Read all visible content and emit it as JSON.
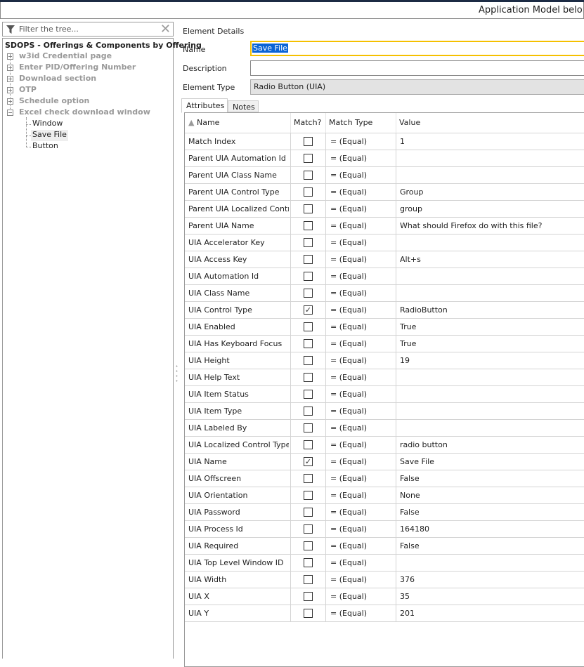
{
  "window": {
    "title": "Application Model belong"
  },
  "filter": {
    "placeholder": "Filter the tree..."
  },
  "tree": {
    "root": "SDOPS - Offerings & Components by Offering",
    "nodes": [
      {
        "label": "w3id Credential page",
        "expanded": false
      },
      {
        "label": "Enter PID/Offering Number",
        "expanded": false
      },
      {
        "label": "Download section",
        "expanded": false
      },
      {
        "label": "OTP",
        "expanded": false
      },
      {
        "label": "Schedule option",
        "expanded": false
      },
      {
        "label": "Excel check download window",
        "expanded": true
      }
    ],
    "leaves": [
      "Window",
      "Save File",
      "Button"
    ],
    "selected": "Save File"
  },
  "details": {
    "heading": "Element Details",
    "name_label": "Name",
    "name_value": "Save File",
    "description_label": "Description",
    "description_value": "",
    "type_label": "Element Type",
    "type_value": "Radio Button (UIA)"
  },
  "tabs": [
    "Attributes",
    "Notes"
  ],
  "table": {
    "headers": [
      "Name",
      "Match?",
      "Match Type",
      "Value"
    ],
    "rows": [
      [
        "Match Index",
        false,
        "=  (Equal)",
        "1"
      ],
      [
        "Parent UIA Automation Id",
        false,
        "=  (Equal)",
        ""
      ],
      [
        "Parent UIA Class Name",
        false,
        "=  (Equal)",
        ""
      ],
      [
        "Parent UIA Control Type",
        false,
        "=  (Equal)",
        "Group"
      ],
      [
        "Parent UIA Localized Contr...",
        false,
        "=  (Equal)",
        "group"
      ],
      [
        "Parent UIA Name",
        false,
        "=  (Equal)",
        "What should Firefox do with this file?"
      ],
      [
        "UIA Accelerator Key",
        false,
        "=  (Equal)",
        ""
      ],
      [
        "UIA Access Key",
        false,
        "=  (Equal)",
        "Alt+s"
      ],
      [
        "UIA Automation Id",
        false,
        "=  (Equal)",
        ""
      ],
      [
        "UIA Class Name",
        false,
        "=  (Equal)",
        ""
      ],
      [
        "UIA Control Type",
        true,
        "=  (Equal)",
        "RadioButton"
      ],
      [
        "UIA Enabled",
        false,
        "=  (Equal)",
        "True"
      ],
      [
        "UIA Has Keyboard Focus",
        false,
        "=  (Equal)",
        "True"
      ],
      [
        "UIA Height",
        false,
        "=  (Equal)",
        "19"
      ],
      [
        "UIA Help Text",
        false,
        "=  (Equal)",
        ""
      ],
      [
        "UIA Item Status",
        false,
        "=  (Equal)",
        ""
      ],
      [
        "UIA Item Type",
        false,
        "=  (Equal)",
        ""
      ],
      [
        "UIA Labeled By",
        false,
        "=  (Equal)",
        ""
      ],
      [
        "UIA Localized Control Type",
        false,
        "=  (Equal)",
        "radio button"
      ],
      [
        "UIA Name",
        true,
        "=  (Equal)",
        "Save File"
      ],
      [
        "UIA Offscreen",
        false,
        "=  (Equal)",
        "False"
      ],
      [
        "UIA Orientation",
        false,
        "=  (Equal)",
        "None"
      ],
      [
        "UIA Password",
        false,
        "=  (Equal)",
        "False"
      ],
      [
        "UIA Process Id",
        false,
        "=  (Equal)",
        "164180"
      ],
      [
        "UIA Required",
        false,
        "=  (Equal)",
        "False"
      ],
      [
        "UIA Top Level Window ID",
        false,
        "=  (Equal)",
        ""
      ],
      [
        "UIA Width",
        false,
        "=  (Equal)",
        "376"
      ],
      [
        "UIA X",
        false,
        "=  (Equal)",
        "35"
      ],
      [
        "UIA Y",
        false,
        "=  (Equal)",
        "201"
      ]
    ]
  }
}
